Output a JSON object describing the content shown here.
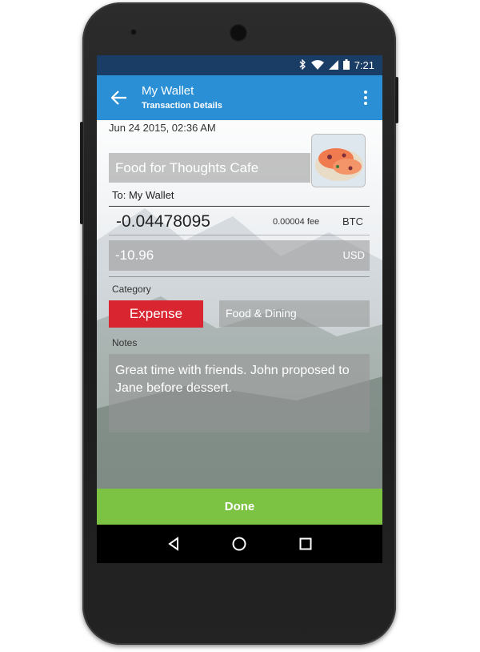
{
  "status_bar": {
    "time": "7:21",
    "icons": [
      "bluetooth-icon",
      "wifi-icon",
      "signal-icon",
      "battery-icon"
    ]
  },
  "app_bar": {
    "title": "My Wallet",
    "subtitle": "Transaction Details",
    "back_icon": "arrow-left-icon",
    "menu_icon": "more-vert-icon"
  },
  "transaction": {
    "date": "Jun 24 2015, 02:36 AM",
    "merchant": "Food for Thoughts Cafe",
    "to": "To: My Wallet",
    "amount_btc": "-0.04478095",
    "fee": "0.00004 fee",
    "btc_unit": "BTC",
    "amount_usd": "-10.96",
    "usd_unit": "USD"
  },
  "category": {
    "label": "Category",
    "type_button": "Expense",
    "value": "Food & Dining"
  },
  "notes": {
    "label": "Notes",
    "text": "Great time with friends.  John proposed to Jane before dessert."
  },
  "done_label": "Done",
  "colors": {
    "status_bar": "#1a3d66",
    "app_bar": "#2b8fd6",
    "expense": "#d9252f",
    "done": "#7cc243"
  }
}
